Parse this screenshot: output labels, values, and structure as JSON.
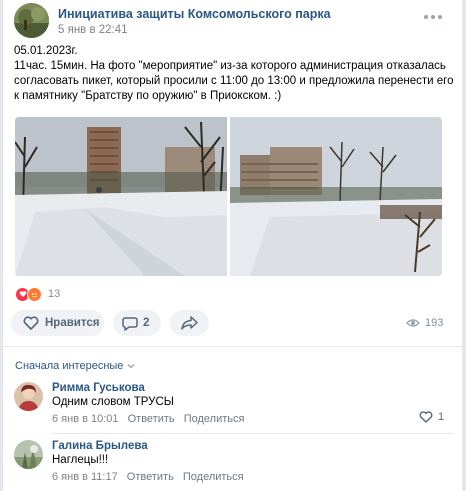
{
  "post": {
    "group_name": "Инициатива защиты Комсомольского парка",
    "time": "5 янв в 22:41",
    "text_lines": [
      "05.01.2023г.",
      "11час. 15мин. На фото \"мероприятие\" из-за которого администрация отказалась",
      "согласовать пикет, который просили с 11:00 до 13:00 и предложила перенести его",
      "к памятнику \"Братству по оружию\" в Приокском. :)"
    ],
    "reactions_count": "13",
    "like_label": "Нравится",
    "comments_count": "2",
    "views_count": "193",
    "icons": {
      "more": "more-icon",
      "like": "heart-icon",
      "comment": "comment-icon",
      "share": "share-icon",
      "views": "eye-icon"
    }
  },
  "comments_section": {
    "sort_label": "Сначала интересные",
    "items": [
      {
        "author": "Римма Гуськова",
        "text": "Одним словом ТРУСЫ",
        "date": "6 янв в 10:01",
        "reply": "Ответить",
        "share": "Поделиться",
        "likes": "1"
      },
      {
        "author": "Галина Брылева",
        "text": "Наглецы!!!",
        "date": "6 янв в 11:17",
        "reply": "Ответить",
        "share": "Поделиться"
      }
    ]
  },
  "colors": {
    "link": "#2a5885",
    "muted": "#818c99",
    "button_bg": "#f0f2f5",
    "reaction_heart": "#ff3347",
    "reaction_angry": "#ff7a2f"
  }
}
